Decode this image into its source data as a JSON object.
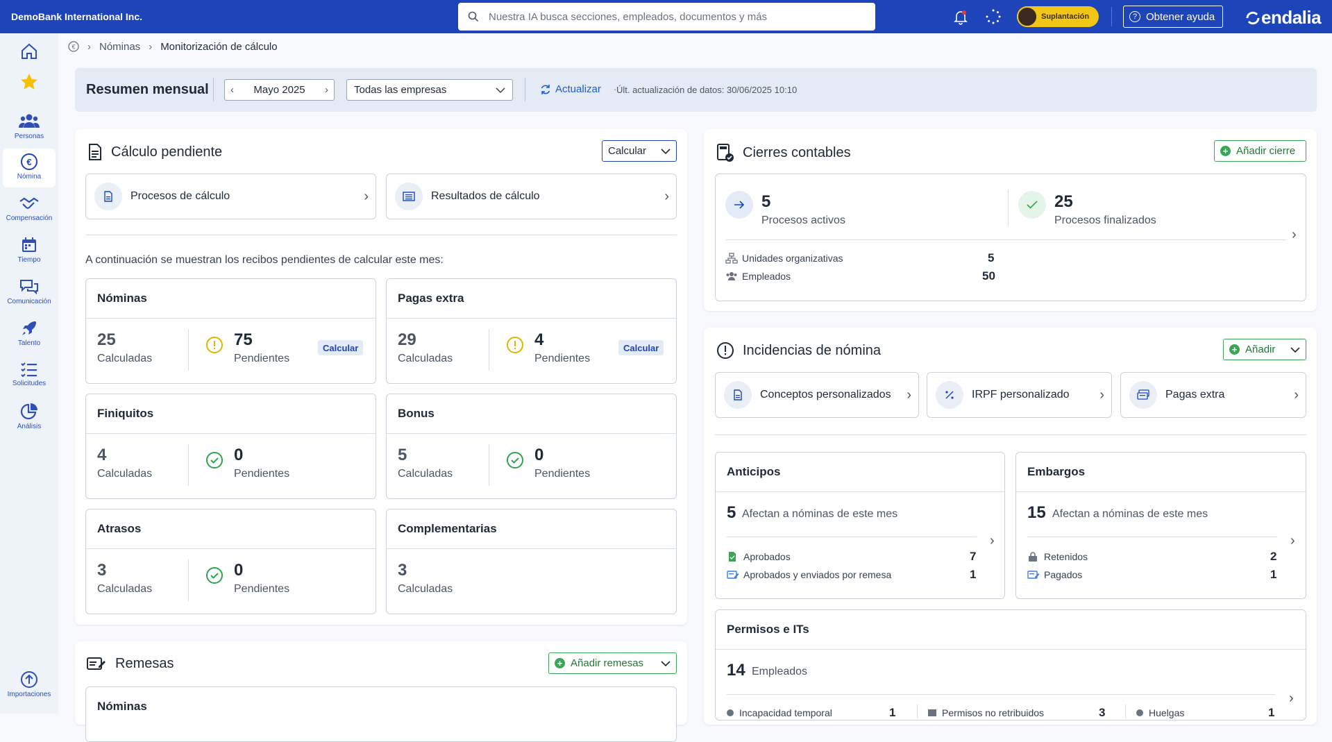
{
  "topbar": {
    "company": "DemoBank International Inc.",
    "search_placeholder": "Nuestra IA busca secciones, empleados, documentos y más",
    "impersonation": "Suplantación",
    "help": "Obtener ayuda",
    "logo": "endalia",
    "colors": {
      "bar": "#1d44b8",
      "badge": "#f3c516"
    }
  },
  "sidebar": {
    "items": [
      {
        "label": "",
        "icon": "home-icon"
      },
      {
        "label": "",
        "icon": "star-icon"
      },
      {
        "label": "Personas",
        "icon": "people-icon"
      },
      {
        "label": "Nómina",
        "icon": "euro-icon"
      },
      {
        "label": "Compensación",
        "icon": "handshake-icon"
      },
      {
        "label": "Tiempo",
        "icon": "calendar-icon"
      },
      {
        "label": "Comunicación",
        "icon": "chat-icon"
      },
      {
        "label": "Talento",
        "icon": "rocket-icon"
      },
      {
        "label": "Solicitudes",
        "icon": "checklist-icon"
      },
      {
        "label": "Análisis",
        "icon": "pie-icon"
      },
      {
        "label": "Importaciones",
        "icon": "upload-icon"
      }
    ]
  },
  "breadcrumb": {
    "section": "Nóminas",
    "current": "Monitorización de cálculo"
  },
  "summary": {
    "title": "Resumen mensual",
    "month": "Mayo 2025",
    "company_filter": "Todas las empresas",
    "refresh": "Actualizar",
    "last_update": "Últ. actualización de datos: 30/06/2025 10:10"
  },
  "calculo": {
    "title": "Cálculo pendiente",
    "calc_button": "Calcular",
    "links": [
      "Procesos de cálculo",
      "Resultados de cálculo"
    ],
    "note": "A continuación se muestran los recibos pendientes de calcular este mes:",
    "calculated_label": "Calculadas",
    "pending_label": "Pendientes",
    "calc_small": "Calcular",
    "boxes": [
      {
        "title": "Nóminas",
        "calculated": "25",
        "pending": "75",
        "status": "warning"
      },
      {
        "title": "Pagas extra",
        "calculated": "29",
        "pending": "4",
        "status": "warning"
      },
      {
        "title": "Finiquitos",
        "calculated": "4",
        "pending": "0",
        "status": "ok"
      },
      {
        "title": "Bonus",
        "calculated": "5",
        "pending": "0",
        "status": "ok"
      },
      {
        "title": "Atrasos",
        "calculated": "3",
        "pending": "0",
        "status": "ok"
      },
      {
        "title": "Complementarias",
        "calculated": "3",
        "pending": "",
        "status": "none"
      }
    ]
  },
  "remesas": {
    "title": "Remesas",
    "add": "Añadir remesas",
    "sub_title": "Nóminas"
  },
  "cierres": {
    "title": "Cierres contables",
    "add": "Añadir cierre",
    "active_count": "5",
    "active_label": "Procesos activos",
    "finished_count": "25",
    "finished_label": "Procesos finalizados",
    "units_label": "Unidades organizativas",
    "units_value": "5",
    "employees_label": "Empleados",
    "employees_value": "50"
  },
  "incidencias": {
    "title": "Incidencias de nómina",
    "add": "Añadir",
    "links": [
      "Conceptos personalizados",
      "IRPF personalizado",
      "Pagas extra"
    ],
    "anticipos": {
      "title": "Anticipos",
      "count": "5",
      "desc": "Afectan a nóminas de este mes",
      "row1_label": "Aprobados",
      "row1_value": "7",
      "row2_label": "Aprobados y enviados por remesa",
      "row2_value": "1"
    },
    "embargos": {
      "title": "Embargos",
      "count": "15",
      "desc": "Afectan a nóminas de este mes",
      "row1_label": "Retenidos",
      "row1_value": "2",
      "row2_label": "Pagados",
      "row2_value": "1"
    },
    "permisos": {
      "title": "Permisos e ITs",
      "count": "14",
      "desc": "Empleados",
      "items": [
        {
          "label": "Incapacidad temporal",
          "value": "1"
        },
        {
          "label": "Permisos no retribuidos",
          "value": "3"
        },
        {
          "label": "Huelgas",
          "value": "1"
        }
      ]
    }
  }
}
